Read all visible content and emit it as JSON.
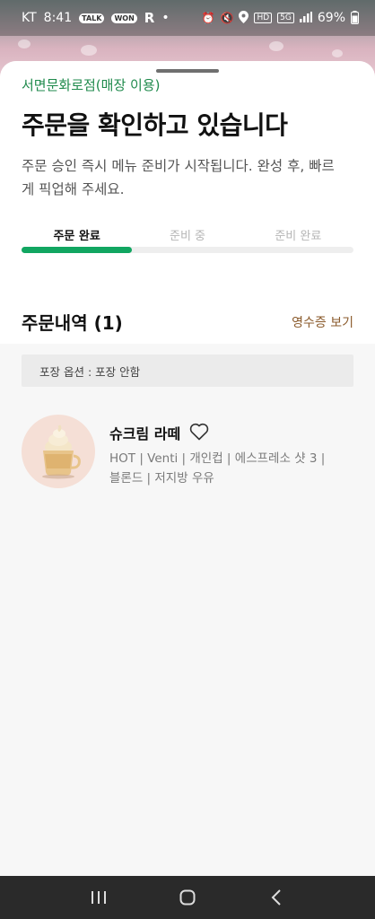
{
  "status_bar": {
    "carrier": "KT",
    "time": "8:41",
    "notif_talk": "TALK",
    "notif_won": "WON",
    "notif_r": "R",
    "notif_dot": "•",
    "hd_badge": "HD",
    "lte_badge": "5G",
    "battery": "69%"
  },
  "order_status": {
    "store_name": "서면문화로점(매장 이용)",
    "title": "주문을 확인하고 있습니다",
    "description": "주문 승인 즉시 메뉴 준비가 시작됩니다. 완성 후, 빠르게 픽업해 주세요.",
    "steps": [
      {
        "label": "주문 완료",
        "active": true
      },
      {
        "label": "준비 중",
        "active": false
      },
      {
        "label": "준비 완료",
        "active": false
      }
    ],
    "progress_fraction": 0.333,
    "progress_color": "#11a661"
  },
  "order_details": {
    "section_title": "주문내역 (1)",
    "receipt_link": "영수증 보기",
    "packaging_option": "포장 옵션 : 포장 안함",
    "items": [
      {
        "name": "슈크림 라떼",
        "options": "HOT | Venti | 개인컵 | 에스프레소 샷 3 | 블론드 | 저지방 우유",
        "image_icon": "cream-latte-cup"
      }
    ]
  },
  "nav": {
    "recents_icon": "recent-apps-icon",
    "home_icon": "home-icon",
    "back_icon": "back-icon"
  },
  "colors": {
    "accent_green": "#1f8a4c",
    "link_brown": "#8a5a2b"
  }
}
